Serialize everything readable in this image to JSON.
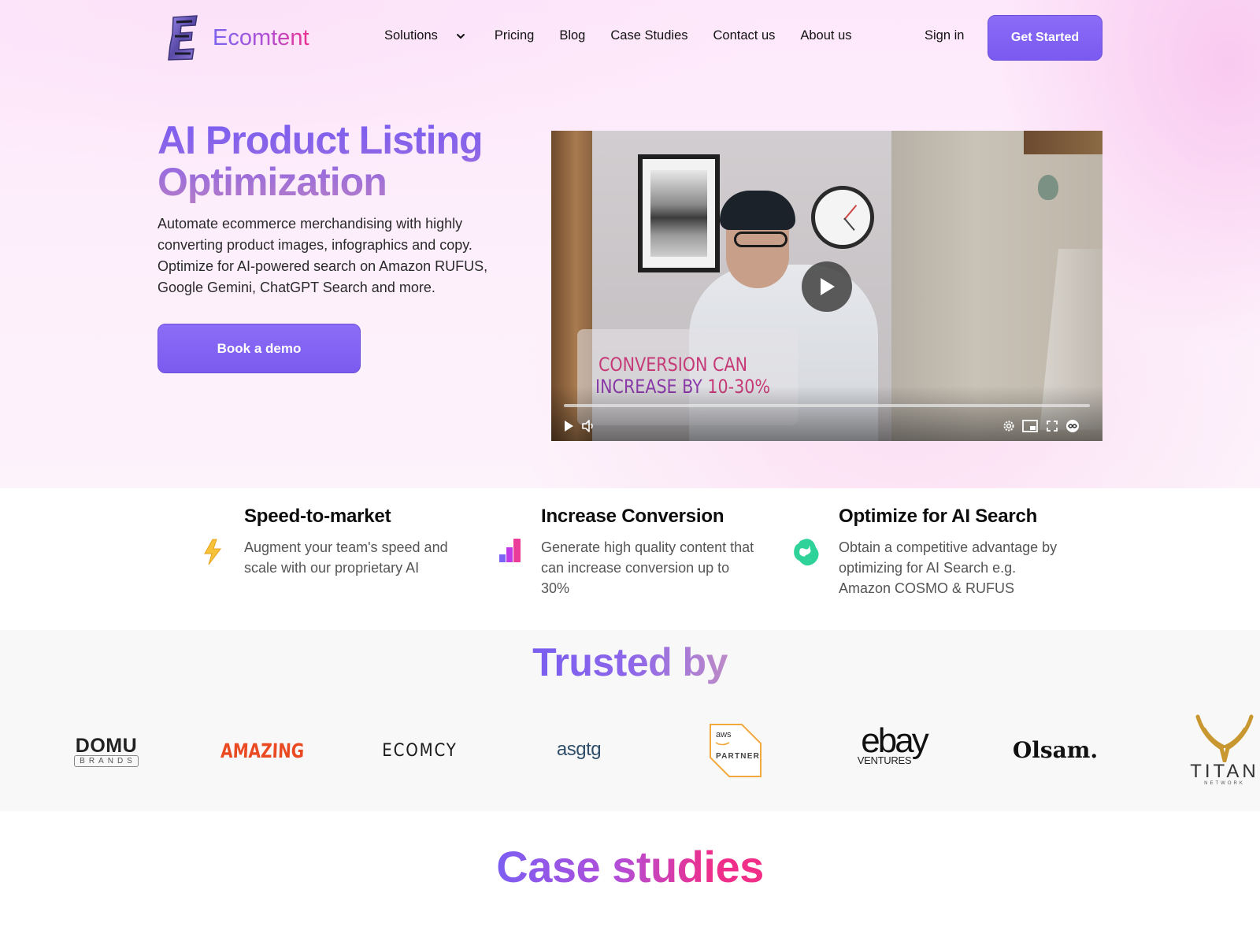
{
  "brand": {
    "name": "Ecomtent",
    "colors": {
      "accent": "#7b5cf0",
      "pink": "#ec2f8e",
      "gradient_start": "#7a5ef0",
      "gradient_end": "#ec2f8e"
    }
  },
  "nav": {
    "items": [
      {
        "label": "Solutions",
        "has_dropdown": true
      },
      {
        "label": "Pricing"
      },
      {
        "label": "Blog"
      },
      {
        "label": "Case Studies"
      },
      {
        "label": "Contact us"
      },
      {
        "label": "About us"
      }
    ],
    "sign_in": "Sign in",
    "cta": "Get Started"
  },
  "hero": {
    "title_line1": "AI Product Listing",
    "title_line2": "Optimization",
    "description": "Automate ecommerce merchandising with highly converting product images, infographics and copy. Optimize for AI-powered search on Amazon RUFUS, Google Gemini, ChatGPT Search and more.",
    "cta": "Book a demo"
  },
  "video": {
    "caption_line1": "CONVERSION CAN",
    "caption_line2a": "INCREASE BY",
    "caption_line2b": "10-30%",
    "progress": 0,
    "controls": [
      "play-icon",
      "volume-icon",
      "settings-icon",
      "miniplayer-icon",
      "fullscreen-icon",
      "loop-icon"
    ]
  },
  "features": [
    {
      "icon": "lightning-bolt-icon",
      "title": "Speed-to-market",
      "description": "Augment your team's speed and scale with our proprietary AI"
    },
    {
      "icon": "bar-chart-icon",
      "title": "Increase Conversion",
      "description": "Generate high quality content that can increase conversion up to 30%"
    },
    {
      "icon": "knot-icon",
      "title": "Optimize for AI Search",
      "description": "Obtain a competitive advantage by optimizing for AI Search e.g. Amazon COSMO & RUFUS"
    }
  ],
  "trusted": {
    "title": "Trusted by",
    "logos": [
      {
        "name": "DOMU",
        "sub": "BRANDS"
      },
      {
        "name": "AMAZING"
      },
      {
        "name": "ECOMCY"
      },
      {
        "name": "asgtg"
      },
      {
        "name": "aws",
        "sub": "PARTNER"
      },
      {
        "name": "ebay",
        "sub": "VENTURES"
      },
      {
        "name": "Olsam."
      },
      {
        "name": "TITAN",
        "sub": "NETWORK"
      }
    ]
  },
  "case_studies": {
    "title": "Case studies"
  }
}
